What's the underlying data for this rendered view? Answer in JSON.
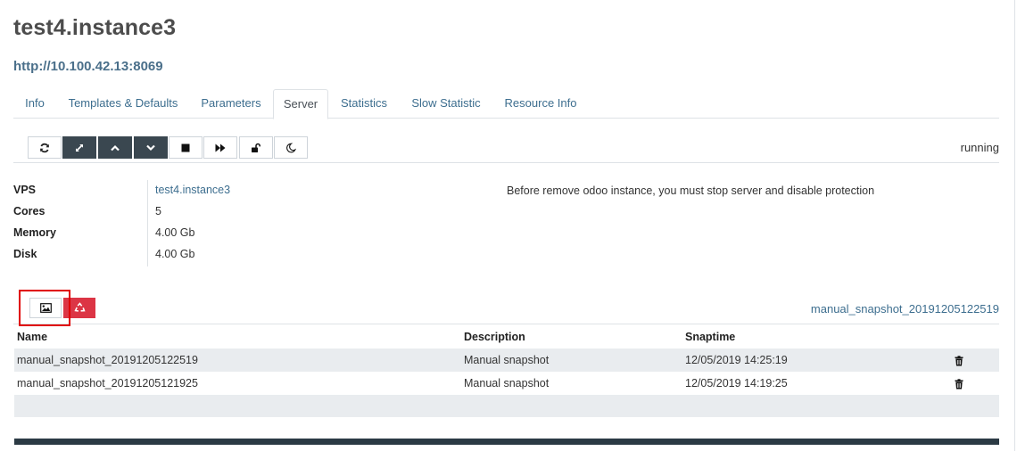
{
  "page": {
    "title": "test4.instance3",
    "url": "http://10.100.42.13:8069"
  },
  "tabs": [
    {
      "label": "Info",
      "active": false
    },
    {
      "label": "Templates & Defaults",
      "active": false
    },
    {
      "label": "Parameters",
      "active": false
    },
    {
      "label": "Server",
      "active": true
    },
    {
      "label": "Statistics",
      "active": false
    },
    {
      "label": "Slow Statistic",
      "active": false
    },
    {
      "label": "Resource Info",
      "active": false
    }
  ],
  "toolbar": {
    "buttons": [
      {
        "icon": "refresh-icon",
        "style": "light"
      },
      {
        "icon": "expand-icon",
        "style": "dark"
      },
      {
        "icon": "chevron-up-icon",
        "style": "dark"
      },
      {
        "icon": "chevron-down-icon",
        "style": "dark"
      },
      {
        "icon": "stop-icon",
        "style": "light"
      },
      {
        "icon": "fast-forward-icon",
        "style": "light"
      },
      {
        "icon": "unlock-icon",
        "style": "light"
      },
      {
        "icon": "moon-icon",
        "style": "light"
      }
    ],
    "status": "running"
  },
  "server_info": {
    "rows": [
      {
        "label": "VPS",
        "value": "test4.instance3"
      },
      {
        "label": "Cores",
        "value": "5"
      },
      {
        "label": "Memory",
        "value": "4.00 Gb"
      },
      {
        "label": "Disk",
        "value": "4.00 Gb"
      }
    ],
    "notice": "Before remove odoo instance, you must stop server and disable protection"
  },
  "snapshots": {
    "current": "manual_snapshot_20191205122519",
    "headers": {
      "name": "Name",
      "description": "Description",
      "snaptime": "Snaptime"
    },
    "rows": [
      {
        "name": "manual_snapshot_20191205122519",
        "description": "Manual snapshot",
        "snaptime": "12/05/2019 14:25:19"
      },
      {
        "name": "manual_snapshot_20191205121925",
        "description": "Manual snapshot",
        "snaptime": "12/05/2019 14:19:25"
      }
    ]
  },
  "colors": {
    "link": "#3d6e8f",
    "dark_button": "#3a4750",
    "danger": "#dc3545",
    "highlight": "#e00000"
  }
}
